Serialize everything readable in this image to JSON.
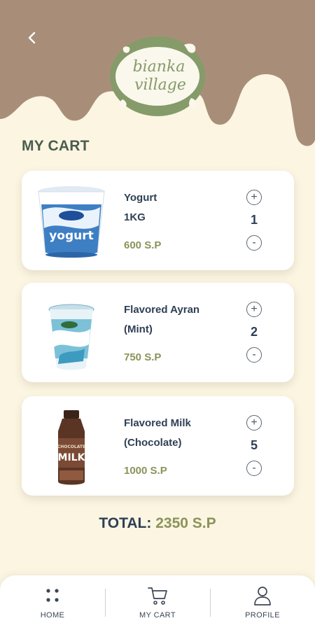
{
  "colors": {
    "background": "#fbf5e2",
    "header_brown": "#a88e79",
    "logo_green": "#859b6a",
    "accent_olive": "#8b935a",
    "text_dark": "#2f4055",
    "title_green": "#4a5d4e"
  },
  "header": {
    "back_icon": "chevron-left-icon",
    "logo": {
      "line1": "bianka",
      "line2": "village"
    }
  },
  "page": {
    "title": "MY CART"
  },
  "cart": {
    "items": [
      {
        "name_line1": "Yogurt",
        "name_line2": "1KG",
        "price": "600 S.P",
        "quantity": "1",
        "image": "yogurt-tub"
      },
      {
        "name_line1": "Flavored Ayran",
        "name_line2": "(Mint)",
        "price": "750 S.P",
        "quantity": "2",
        "image": "ayran-cup"
      },
      {
        "name_line1": "Flavored Milk",
        "name_line2": "(Chocolate)",
        "price": "1000 S.P",
        "quantity": "5",
        "image": "chocolate-milk-bottle"
      }
    ],
    "plus_symbol": "+",
    "minus_symbol": "-"
  },
  "total": {
    "label": "TOTAL:",
    "value": "2350 S.P"
  },
  "nav": {
    "items": [
      {
        "label": "HOME",
        "icon": "grid-dots-icon"
      },
      {
        "label": "MY CART",
        "icon": "cart-icon"
      },
      {
        "label": "PROFILE",
        "icon": "user-icon"
      }
    ]
  }
}
